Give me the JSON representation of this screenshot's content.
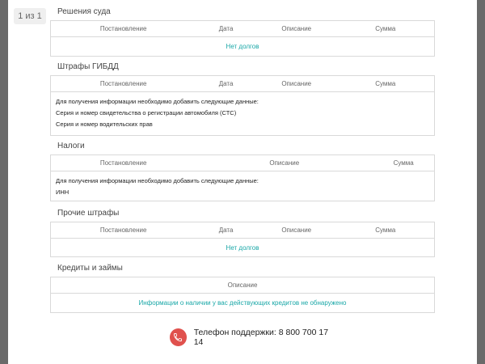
{
  "pager": {
    "label": "1 из 1"
  },
  "sections": {
    "court": {
      "title": "Решения суда",
      "columns": [
        "Постановление",
        "Дата",
        "Описание",
        "Сумма"
      ],
      "message": "Нет долгов"
    },
    "gibdd": {
      "title": "Штрафы ГИБДД",
      "columns": [
        "Постановление",
        "Дата",
        "Описание",
        "Сумма"
      ],
      "notice": [
        "Для получения информации необходимо добавить следующие данные:",
        "Серия и номер свидетельства о регистрации автомобиля (СТС)",
        "Серия и номер водительских прав"
      ]
    },
    "taxes": {
      "title": "Налоги",
      "columns": [
        "Постановление",
        "Описание",
        "Сумма"
      ],
      "notice": [
        "Для получения информации необходимо добавить следующие данные:",
        "ИНН"
      ]
    },
    "other": {
      "title": "Прочие штрафы",
      "columns": [
        "Постановление",
        "Дата",
        "Описание",
        "Сумма"
      ],
      "message": "Нет долгов"
    },
    "credits": {
      "title": "Кредиты и займы",
      "columns": [
        "Описание"
      ],
      "message": "Информации о наличии у вас действующих кредитов не обнаружено"
    }
  },
  "support": {
    "icon": "phone-icon",
    "text": "Телефон поддержки: 8 800 700 17 14",
    "accent": "#e0514d"
  },
  "colors": {
    "link": "#19a7a7",
    "border": "#d9d9d9"
  }
}
